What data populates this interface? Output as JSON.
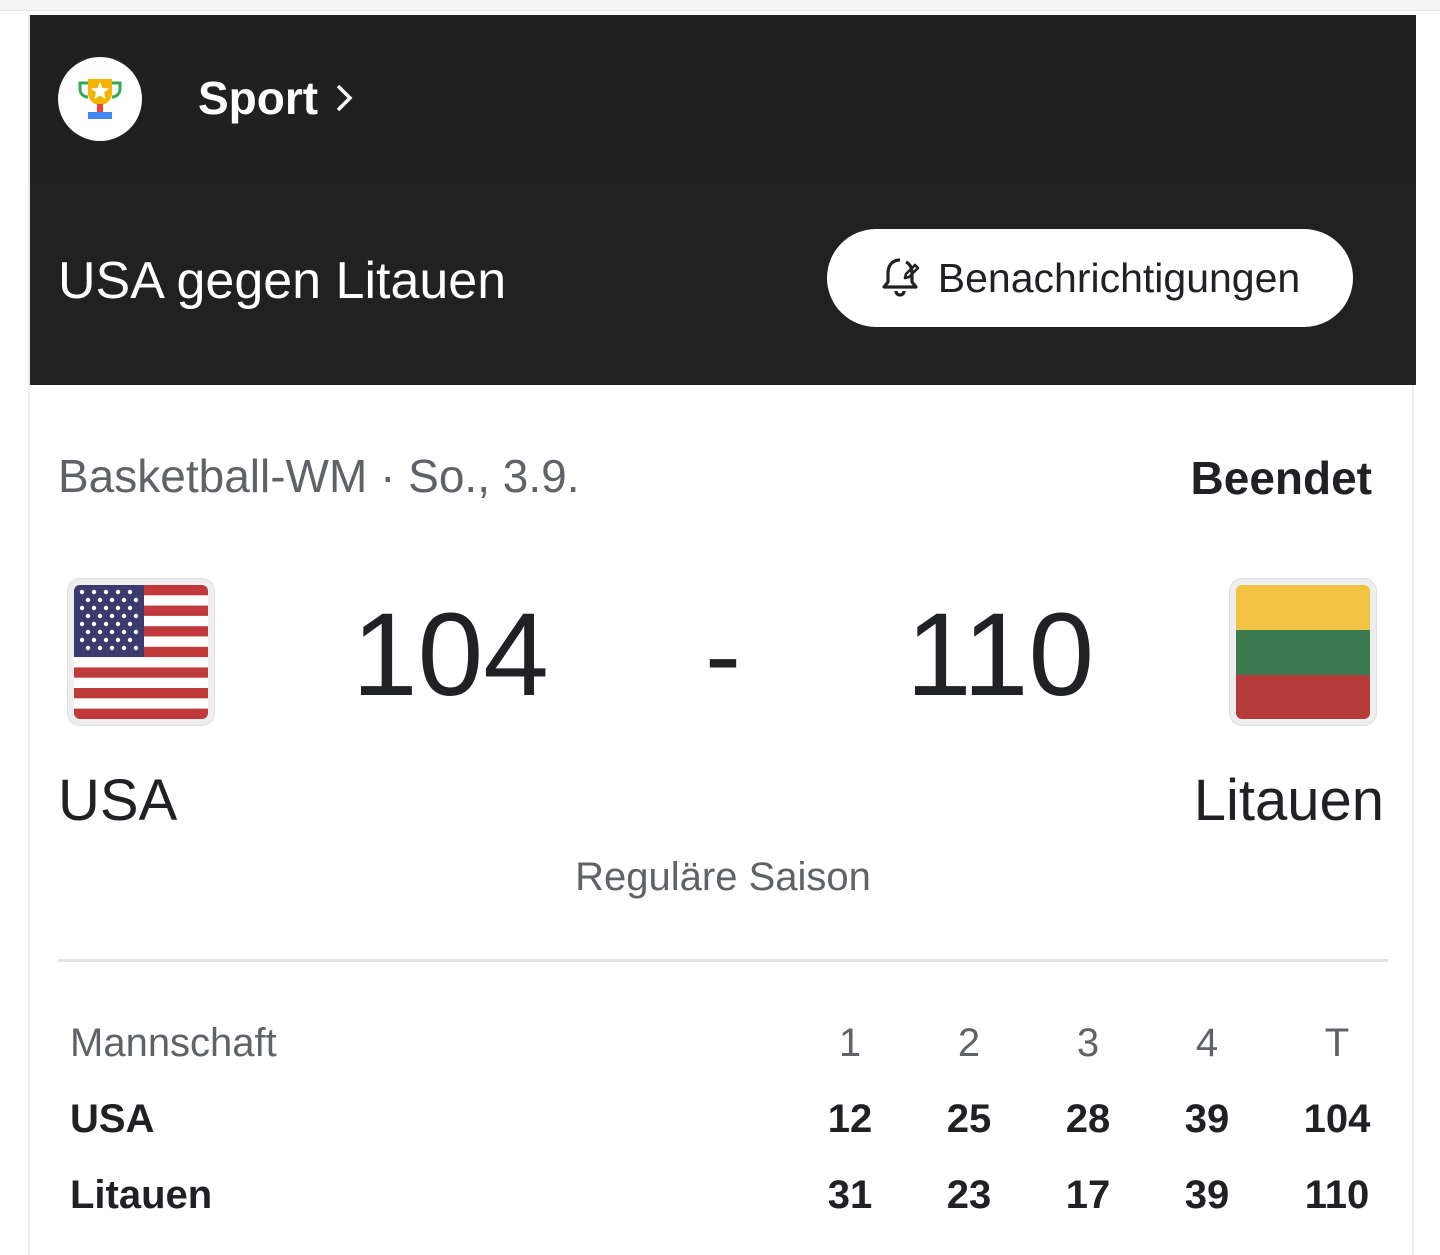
{
  "header": {
    "section_label": "Sport",
    "trophy_icon": "trophy-icon",
    "chevron_icon": "chevron-right-icon"
  },
  "title_bar": {
    "match_title": "USA gegen Litauen",
    "notify_label": "Benachrichtigungen",
    "notify_icon": "bell-edit-icon"
  },
  "match": {
    "competition_date": "Basketball-WM · So., 3.9.",
    "status": "Beendet",
    "home": {
      "name": "USA",
      "score": "104",
      "flag_icon": "usa-flag-icon"
    },
    "away": {
      "name": "Litauen",
      "score": "110",
      "flag_icon": "lithuania-flag-icon"
    },
    "separator": "-",
    "season_type": "Reguläre Saison"
  },
  "boxscore": {
    "headers": [
      "Mannschaft",
      "1",
      "2",
      "3",
      "4",
      "T"
    ],
    "rows": [
      [
        "USA",
        "12",
        "25",
        "28",
        "39",
        "104"
      ],
      [
        "Litauen",
        "31",
        "23",
        "17",
        "39",
        "110"
      ]
    ]
  },
  "colors": {
    "header_bg": "#202020",
    "text_primary": "#202124",
    "text_secondary": "#5f6368",
    "ltu_yellow": "#f2c243",
    "ltu_green": "#3a7a4e",
    "ltu_red": "#b53a3a"
  }
}
